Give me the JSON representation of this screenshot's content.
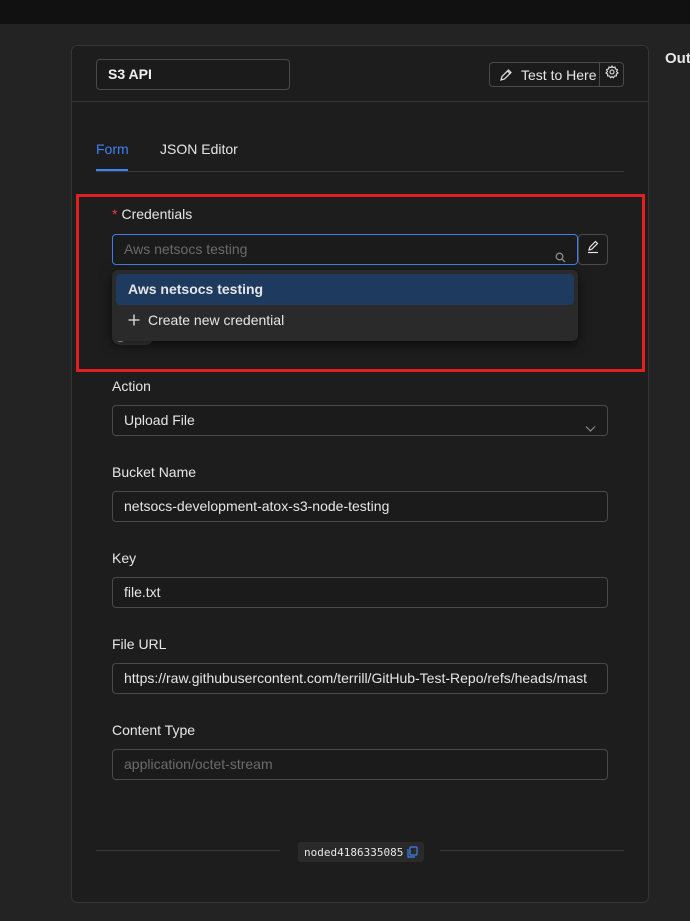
{
  "outside_label": "Out",
  "header": {
    "node_name": "S3 API",
    "test_button_label": "Test to Here"
  },
  "tabs": [
    {
      "label": "Form",
      "active": true
    },
    {
      "label": "JSON Editor",
      "active": false
    }
  ],
  "credentials": {
    "required_marker": "*",
    "label": "Credentials",
    "placeholder": "Aws netsocs testing",
    "dropdown": {
      "selected": "Aws netsocs testing",
      "create_new": "Create new credential"
    }
  },
  "fields": {
    "action": {
      "label": "Action",
      "value": "Upload File"
    },
    "bucket_name": {
      "label": "Bucket Name",
      "value": "netsocs-development-atox-s3-node-testing"
    },
    "key": {
      "label": "Key",
      "value": "file.txt"
    },
    "file_url": {
      "label": "File URL",
      "value": "https://raw.githubusercontent.com/terrill/GitHub-Test-Repo/refs/heads/mast"
    },
    "content_type": {
      "label": "Content Type",
      "placeholder": "application/octet-stream"
    }
  },
  "node_id": "noded4186335085",
  "colors": {
    "accent": "#3b82f6",
    "required": "#e0413a",
    "highlight": "#e0201e",
    "selected_item": "#1e3a5f"
  },
  "icons": [
    "pencil-icon",
    "gear-icon",
    "search-icon",
    "edit-icon",
    "plus-icon",
    "chevron-down-icon",
    "copy-icon"
  ]
}
